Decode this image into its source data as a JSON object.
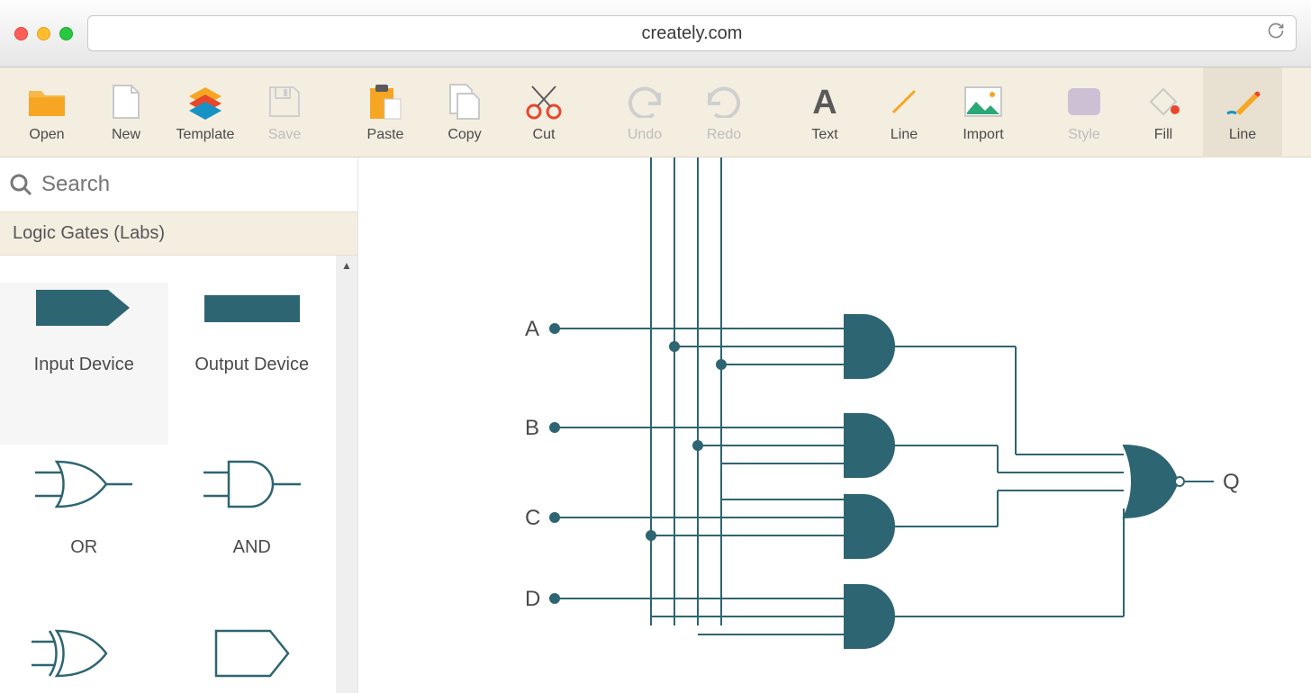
{
  "browser": {
    "url": "creately.com"
  },
  "toolbar": {
    "open": "Open",
    "new": "New",
    "template": "Template",
    "save": "Save",
    "paste": "Paste",
    "copy": "Copy",
    "cut": "Cut",
    "undo": "Undo",
    "redo": "Redo",
    "text": "Text",
    "line": "Line",
    "import": "Import",
    "style": "Style",
    "fill": "Fill",
    "line2": "Line"
  },
  "sidebar": {
    "search_placeholder": "Search",
    "section": "Logic Gates (Labs)",
    "shapes": [
      {
        "label": "Input Device"
      },
      {
        "label": "Output Device"
      },
      {
        "label": "OR"
      },
      {
        "label": "AND"
      }
    ]
  },
  "canvas": {
    "inputs": [
      "A",
      "B",
      "C",
      "D"
    ],
    "output": "Q",
    "gates": [
      {
        "type": "AND",
        "inputs_from": "top lines"
      },
      {
        "type": "AND"
      },
      {
        "type": "AND"
      },
      {
        "type": "AND"
      },
      {
        "type": "OR",
        "output": "Q"
      }
    ]
  },
  "colors": {
    "teal": "#2e6572",
    "toolbar_bg": "#f4eee1",
    "orange": "#f6a623",
    "accent_red": "#e9472b"
  }
}
